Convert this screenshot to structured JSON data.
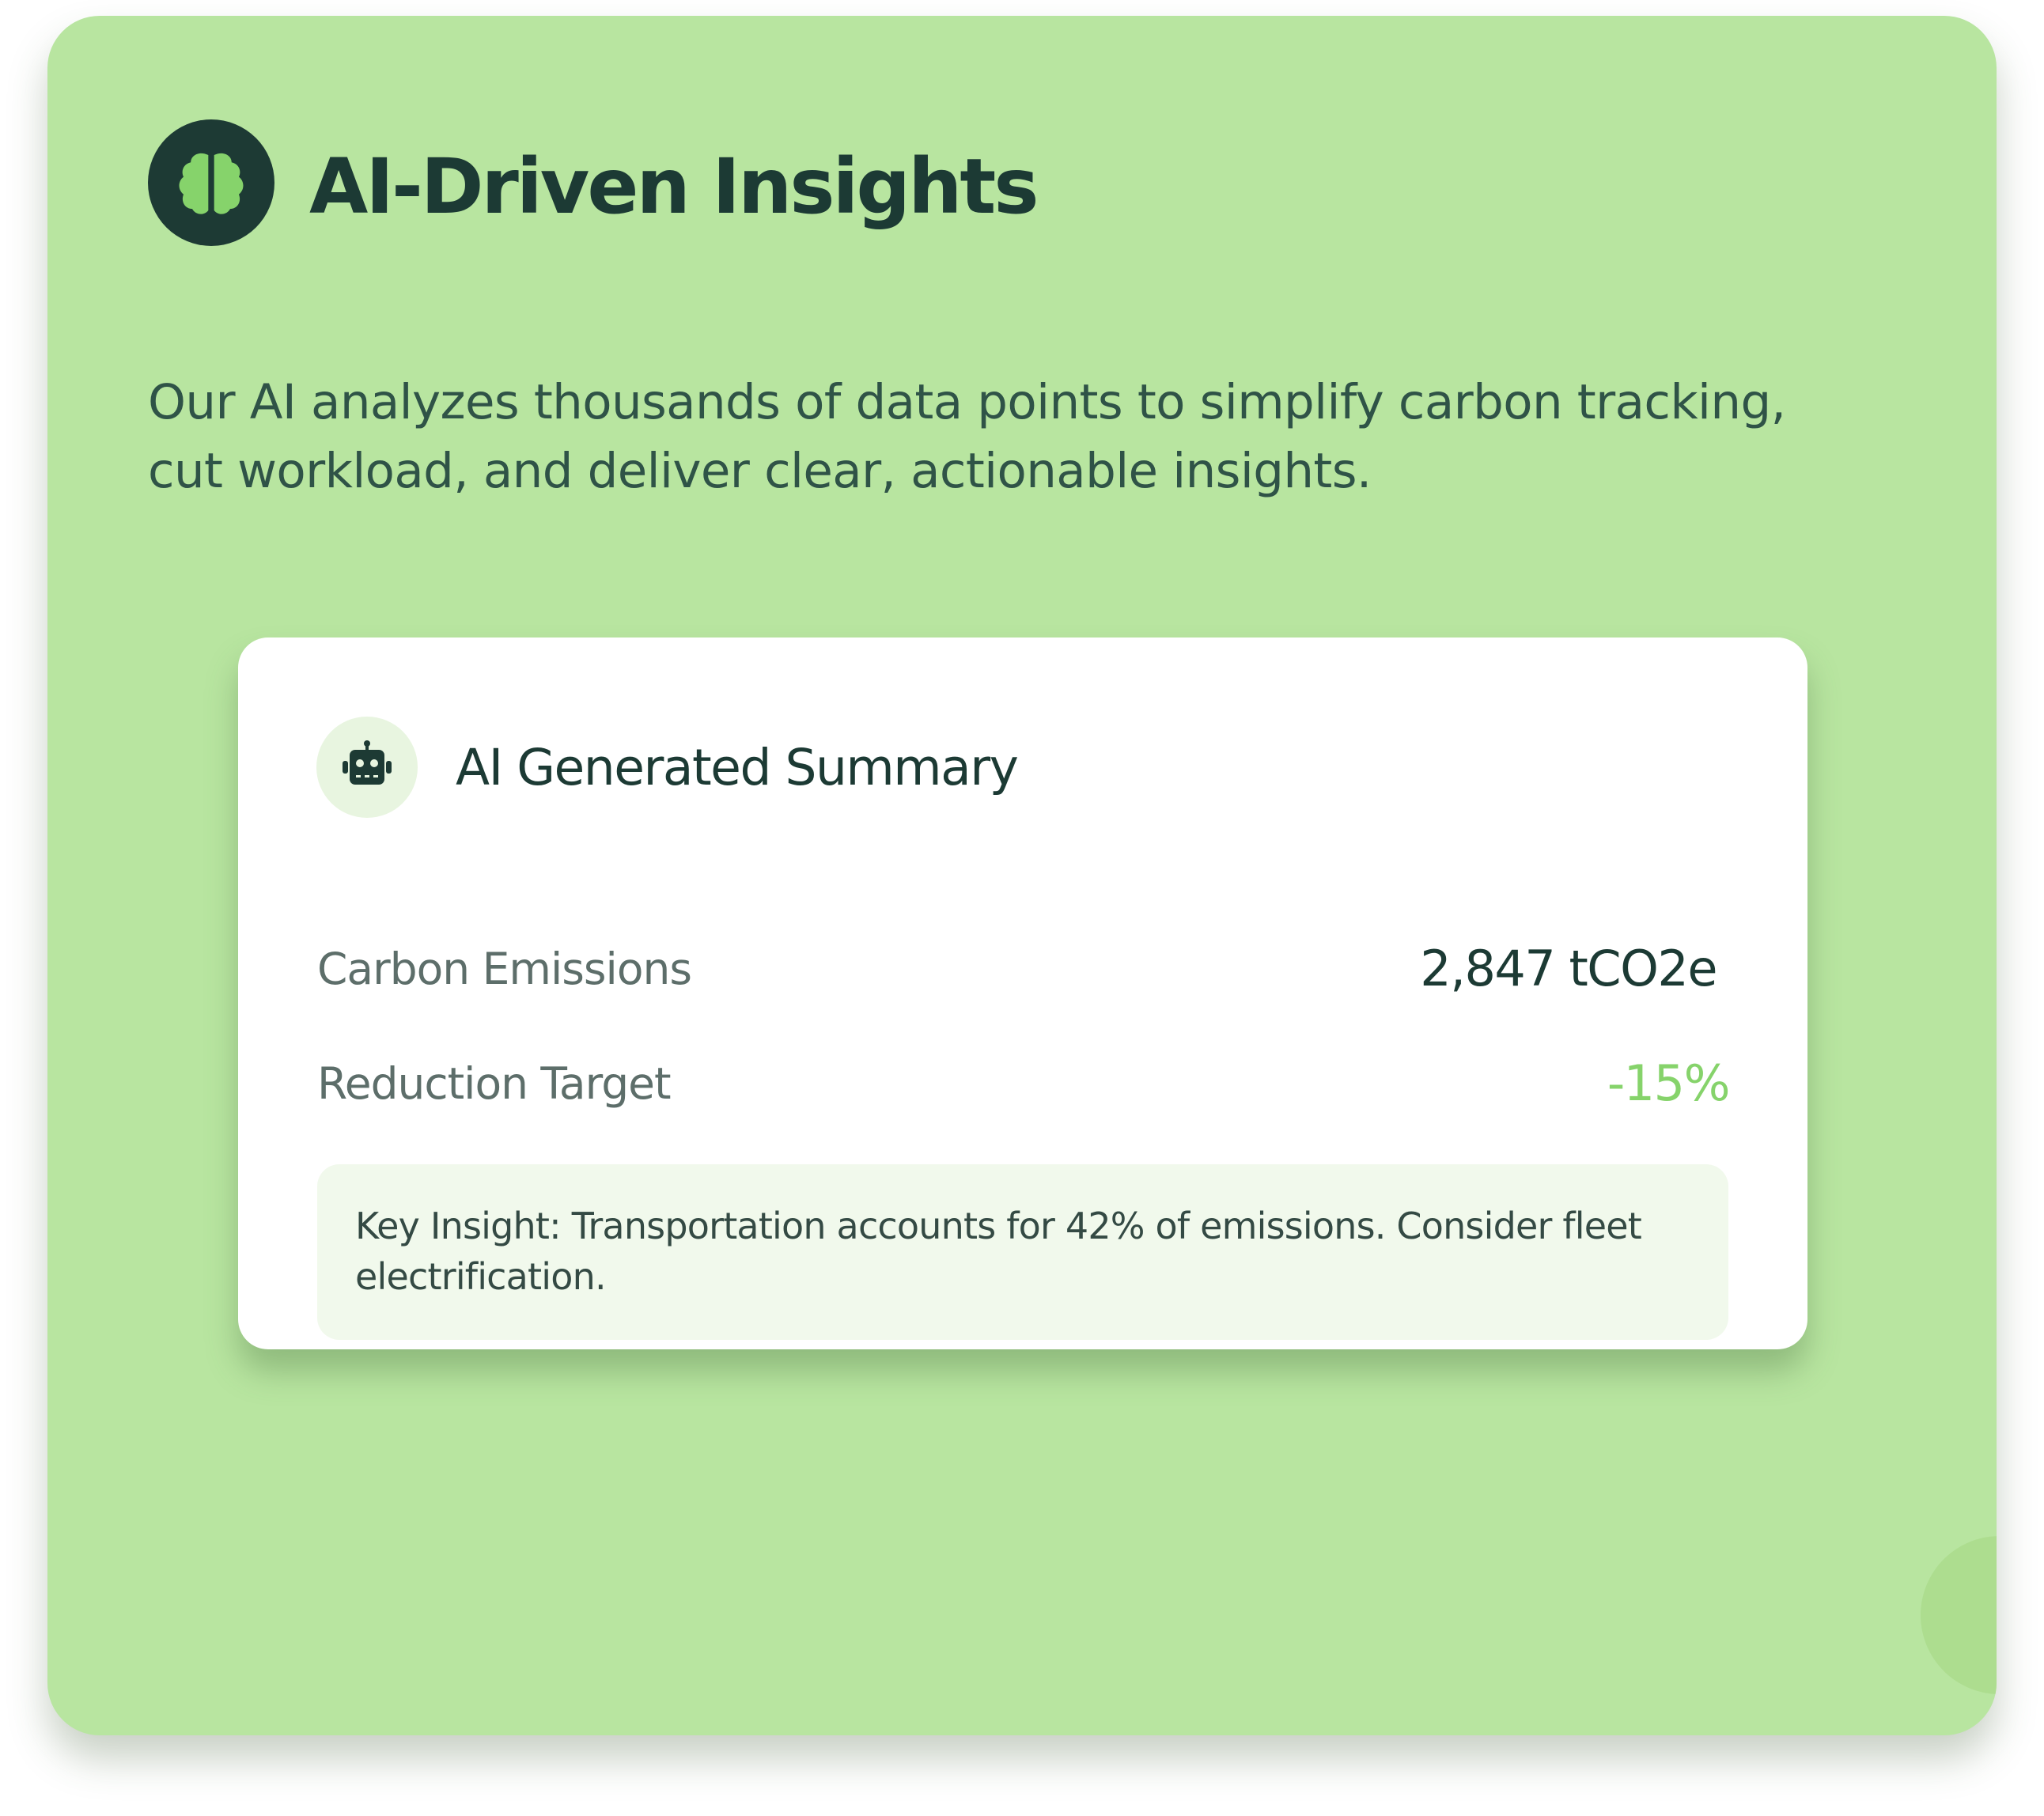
{
  "header": {
    "title": "AI-Driven Insights",
    "icon": "brain-icon",
    "icon_bg": "#1d3a34",
    "icon_color": "#86d36b"
  },
  "description": "Our AI analyzes thousands of data points to simplify carbon tracking, cut workload, and deliver clear, actionable insights.",
  "summary": {
    "icon": "robot-icon",
    "title": "AI Generated Summary",
    "metrics": [
      {
        "label": "Carbon Emissions",
        "value": "2,847 tCO2e"
      },
      {
        "label": "Reduction Target",
        "value": "-15%"
      }
    ],
    "insight": {
      "prefix": "Key Insight:",
      "text": "Transportation accounts for 42% of emissions. Consider fleet electrification."
    }
  },
  "colors": {
    "card_background": "#b8e5a0",
    "accent_green": "#86d36b",
    "dark_text": "#1c3a34",
    "insight_background": "#f1f9ec"
  }
}
